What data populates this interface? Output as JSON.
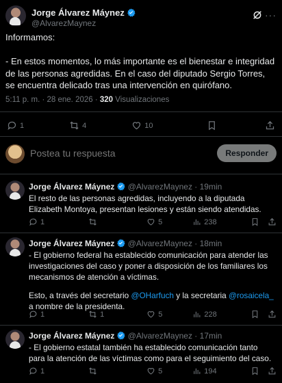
{
  "main": {
    "author_name": "Jorge Álvarez Máynez",
    "handle": "@AlvarezMaynez",
    "text_line1": "Informamos:",
    "text_body": "- En estos momentos, lo más importante es el bienestar e integridad de las personas agredidas. En el caso del diputado Sergio Torres, se encuentra delicado tras una intervención en quirófano.",
    "timestamp": "5:11 p. m. · 28 ene. 2026 ·",
    "views_count": "320",
    "views_label": "Visualizaciones",
    "replies": "1",
    "reposts": "4",
    "likes": "10"
  },
  "composer": {
    "placeholder": "Postea tu respuesta",
    "button_label": "Responder"
  },
  "replies": [
    {
      "name": "Jorge Álvarez Máynez",
      "handle": "@AlvarezMaynez",
      "time": "· 19min",
      "text": "El resto de las personas agredidas, incluyendo a la diputada Elizabeth Montoya, presentan lesiones y están siendo atendidas.",
      "replies": "1",
      "reposts": "",
      "likes": "5",
      "views": "238"
    },
    {
      "name": "Jorge Álvarez Máynez",
      "handle": "@AlvarezMaynez",
      "time": "· 18min",
      "text1": "- El gobierno federal ha establecido comunicación para atender las investigaciones del caso y poner a disposición de los familiares los mecanismos de atención a víctimas.",
      "text2_a": "Esto, a través del secretario ",
      "mention1": "@OHarfuch",
      "text2_b": " y la secretaria ",
      "mention2": "@rosaicela_",
      "text2_c": " a nombre de la presidenta.",
      "replies": "1",
      "reposts": "1",
      "likes": "5",
      "views": "228"
    },
    {
      "name": "Jorge Álvarez Máynez",
      "handle": "@AlvarezMaynez",
      "time": "· 17min",
      "text": "- El gobierno estatal también ha establecido comunicación tanto para la atención de las víctimas como para el seguimiento del caso.",
      "replies": "1",
      "reposts": "",
      "likes": "5",
      "views": "194"
    }
  ],
  "colors": {
    "background": "#000000",
    "text": "#e7e9ea",
    "muted": "#71767b",
    "link": "#1d9bf0",
    "verified": "#1d9bf0",
    "divider": "#2f3336"
  }
}
